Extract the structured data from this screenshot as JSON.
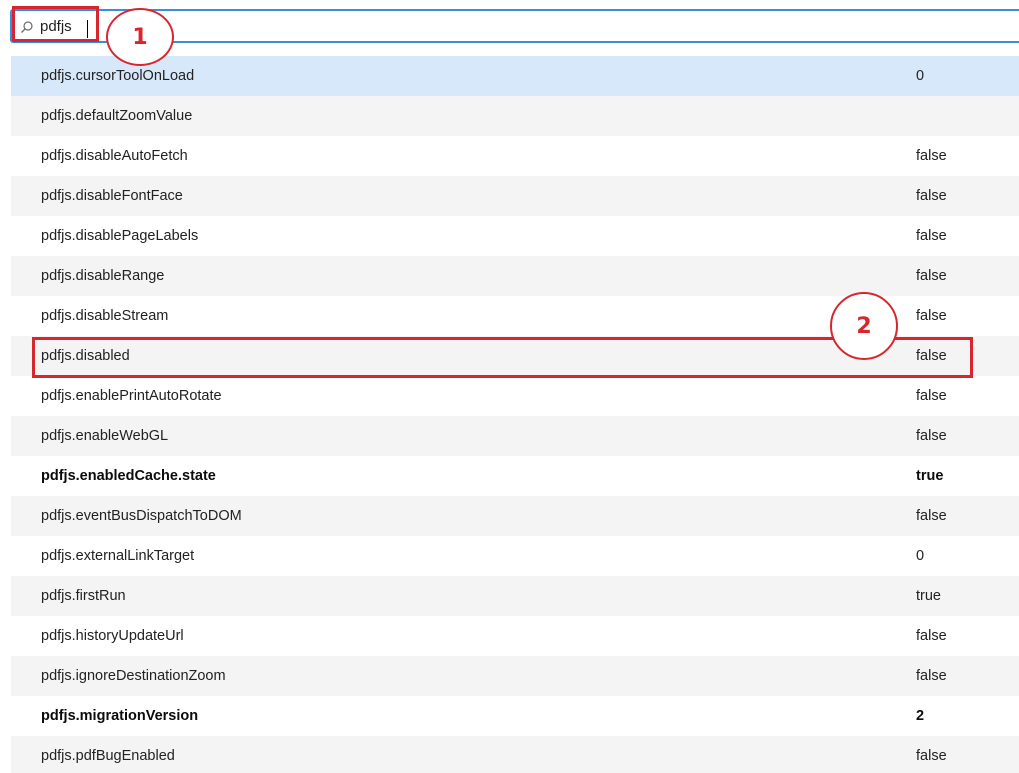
{
  "search": {
    "value": "pdfjs",
    "icon": "search-icon"
  },
  "preferences": [
    {
      "name": "pdfjs.cursorToolOnLoad",
      "value": "0",
      "modified": false
    },
    {
      "name": "pdfjs.defaultZoomValue",
      "value": "",
      "modified": false
    },
    {
      "name": "pdfjs.disableAutoFetch",
      "value": "false",
      "modified": false
    },
    {
      "name": "pdfjs.disableFontFace",
      "value": "false",
      "modified": false
    },
    {
      "name": "pdfjs.disablePageLabels",
      "value": "false",
      "modified": false
    },
    {
      "name": "pdfjs.disableRange",
      "value": "false",
      "modified": false
    },
    {
      "name": "pdfjs.disableStream",
      "value": "false",
      "modified": false
    },
    {
      "name": "pdfjs.disabled",
      "value": "false",
      "modified": false
    },
    {
      "name": "pdfjs.enablePrintAutoRotate",
      "value": "false",
      "modified": false
    },
    {
      "name": "pdfjs.enableWebGL",
      "value": "false",
      "modified": false
    },
    {
      "name": "pdfjs.enabledCache.state",
      "value": "true",
      "modified": true
    },
    {
      "name": "pdfjs.eventBusDispatchToDOM",
      "value": "false",
      "modified": false
    },
    {
      "name": "pdfjs.externalLinkTarget",
      "value": "0",
      "modified": false
    },
    {
      "name": "pdfjs.firstRun",
      "value": "true",
      "modified": false
    },
    {
      "name": "pdfjs.historyUpdateUrl",
      "value": "false",
      "modified": false
    },
    {
      "name": "pdfjs.ignoreDestinationZoom",
      "value": "false",
      "modified": false
    },
    {
      "name": "pdfjs.migrationVersion",
      "value": "2",
      "modified": true
    },
    {
      "name": "pdfjs.pdfBugEnabled",
      "value": "false",
      "modified": false
    }
  ],
  "annotations": {
    "marker_1": "1",
    "marker_2": "2",
    "color": "#d7262e"
  },
  "colors": {
    "focus_border": "#3b8de0",
    "selected_row": "#d8e8fb",
    "alt_row": "#f4f4f4"
  }
}
